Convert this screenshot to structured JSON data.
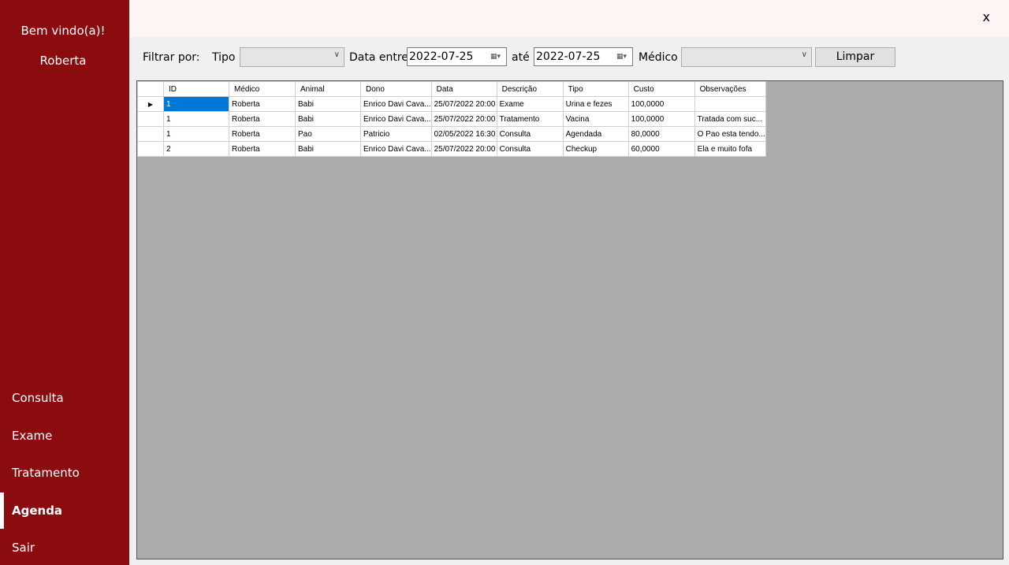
{
  "sidebar": {
    "welcome": "Bem vindo(a)!",
    "username": "Roberta",
    "items": [
      {
        "label": "Consulta",
        "active": false
      },
      {
        "label": "Exame",
        "active": false
      },
      {
        "label": "Tratamento",
        "active": false
      },
      {
        "label": "Agenda",
        "active": true
      },
      {
        "label": "Sair",
        "active": false
      }
    ]
  },
  "topbar": {
    "close_label": "x"
  },
  "filters": {
    "filter_label": "Filtrar por:",
    "tipo_label": "Tipo",
    "tipo_value": "",
    "date_between_label": "Data entre",
    "date_from": "2022-07-25",
    "until_label": "até",
    "date_to": "2022-07-25",
    "medico_label": "Médico",
    "medico_value": "",
    "clear_label": "Limpar"
  },
  "grid": {
    "columns": [
      "ID",
      "Médico",
      "Animal",
      "Dono",
      "Data",
      "Descrição",
      "Tipo",
      "Custo",
      "Observações"
    ],
    "rows": [
      [
        "1",
        "Roberta",
        "Babi",
        "Enrico Davi Cava...",
        "25/07/2022 20:00",
        "Exame",
        "Urina e fezes",
        "100,0000",
        ""
      ],
      [
        "1",
        "Roberta",
        "Babi",
        "Enrico Davi Cava...",
        "25/07/2022 20:00",
        "Tratamento",
        "Vacina",
        "100,0000",
        "Tratada com suc..."
      ],
      [
        "1",
        "Roberta",
        "Pao",
        "Patricio",
        "02/05/2022 16:30",
        "Consulta",
        "Agendada",
        "80,0000",
        "O Pao esta tendo..."
      ],
      [
        "2",
        "Roberta",
        "Babi",
        "Enrico Davi Cava...",
        "25/07/2022 20:00",
        "Consulta",
        "Checkup",
        "60,0000",
        "Ela e muito fofa"
      ]
    ]
  },
  "colors": {
    "sidebar_bg": "#8b0c0f",
    "selection": "#0078d7",
    "grid_bg": "#ababab"
  },
  "icons": {
    "row_indicator": "triangle-right-icon",
    "combo": "chevron-down-icon",
    "date_picker": "calendar-icon"
  }
}
